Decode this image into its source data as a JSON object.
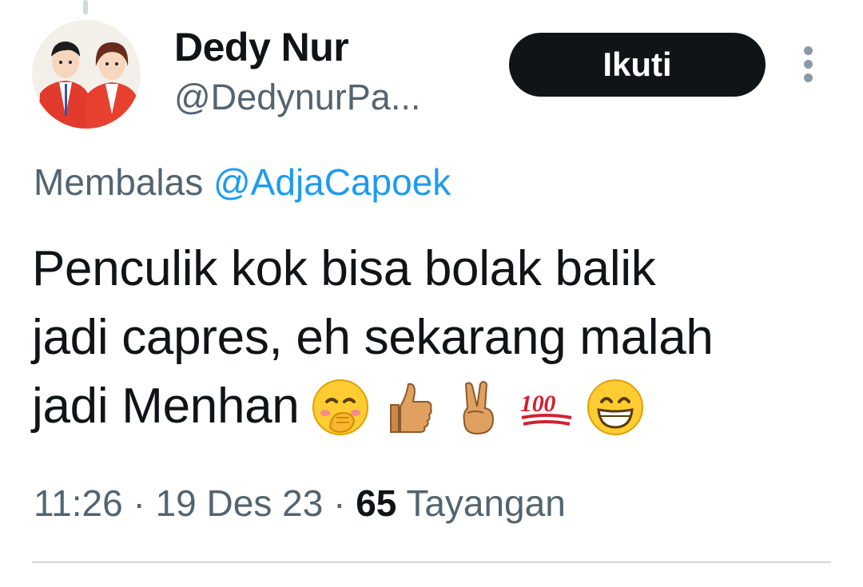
{
  "author": {
    "display_name": "Dedy Nur",
    "handle": "@DedynurPa..."
  },
  "follow_button": {
    "label": "Ikuti"
  },
  "more_icon": "more-vertical-icon",
  "reply": {
    "prefix": "Membalas",
    "mention": "@AdjaCapoek"
  },
  "tweet": {
    "lines": [
      "Penculik kok bisa bolak balik",
      "jadi capres, eh sekarang malah",
      "jadi Menhan"
    ],
    "emojis": [
      "face-with-hand-over-mouth-icon",
      "thumbs-up-icon",
      "victory-hand-icon",
      "hundred-points-icon",
      "grinning-face-icon"
    ]
  },
  "meta": {
    "time": "11:26",
    "separator": "·",
    "date": "19 Des 23",
    "views_count": "65",
    "views_label": "Tayangan"
  },
  "colors": {
    "text_primary": "#0f1419",
    "text_secondary": "#536471",
    "link": "#1d9bf0",
    "button_bg": "#0f1419",
    "divider": "#cfd9de"
  }
}
